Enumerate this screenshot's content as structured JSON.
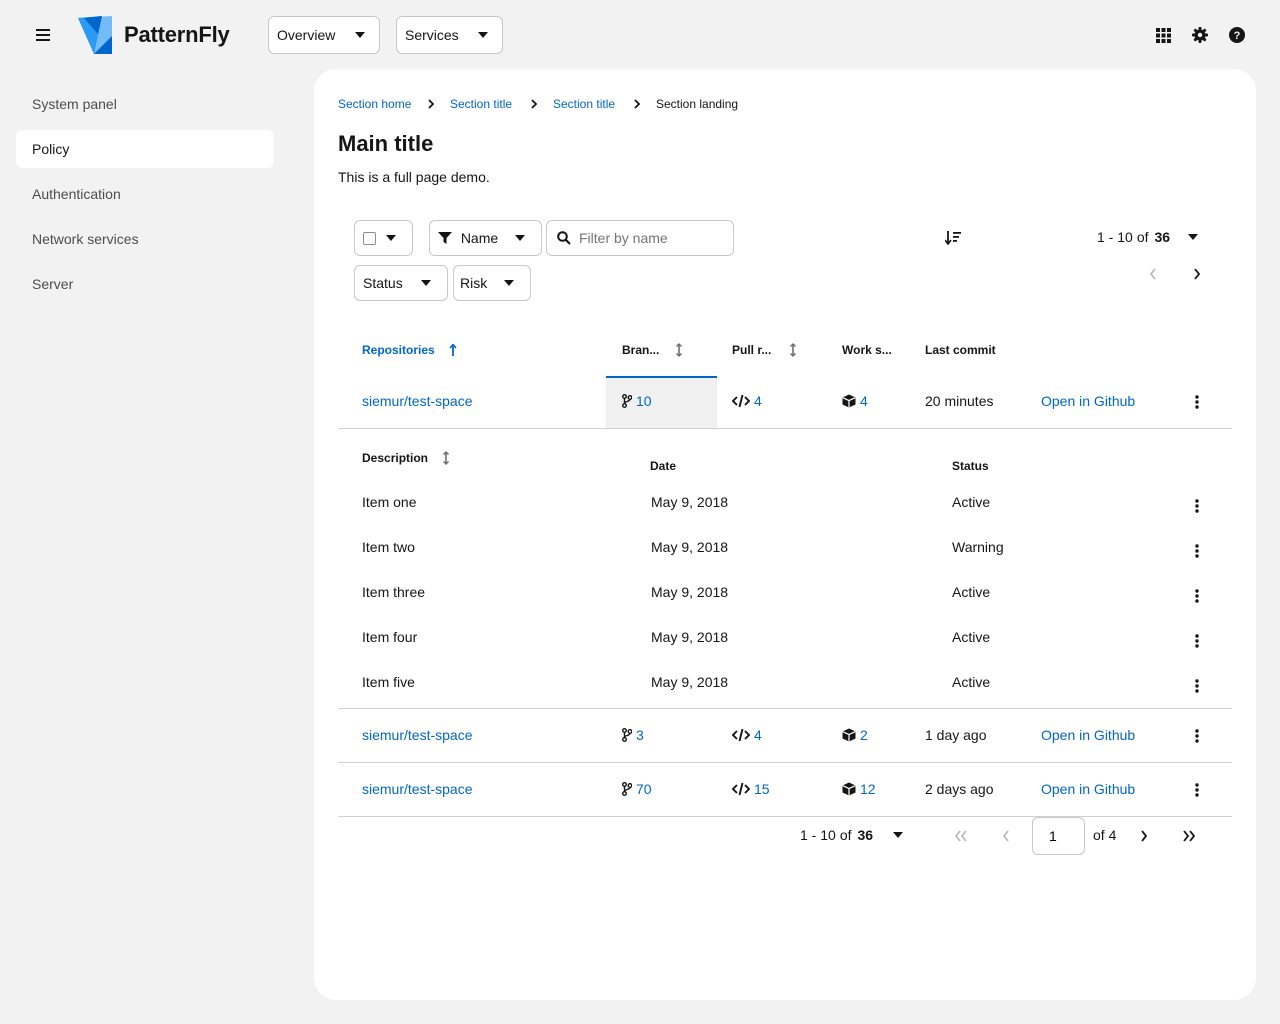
{
  "masthead": {
    "brand": "PatternFly",
    "dropdowns": [
      {
        "label": "Overview"
      },
      {
        "label": "Services"
      }
    ],
    "tools": [
      "apps-grid-icon",
      "settings-icon",
      "help-icon"
    ]
  },
  "sidebar": {
    "items": [
      {
        "label": "System panel",
        "active": false
      },
      {
        "label": "Policy",
        "active": true
      },
      {
        "label": "Authentication",
        "active": false
      },
      {
        "label": "Network services",
        "active": false
      },
      {
        "label": "Server",
        "active": false
      }
    ]
  },
  "breadcrumb": {
    "items": [
      "Section home",
      "Section title",
      "Section title"
    ],
    "current": "Section landing"
  },
  "page": {
    "title": "Main title",
    "description": "This is a full page demo."
  },
  "toolbar": {
    "filter_attribute": "Name",
    "search_placeholder": "Filter by name",
    "status_label": "Status",
    "risk_label": "Risk",
    "pagination_range": "1 - 10",
    "pagination_of": "of",
    "pagination_total": "36"
  },
  "table": {
    "columns": {
      "repositories": "Repositories",
      "branches": "Bran...",
      "pull_requests": "Pull r...",
      "workspaces": "Work s...",
      "last_commit": "Last commit"
    },
    "rows": [
      {
        "repo": "siemur/test-space",
        "branches": "10",
        "pull_requests": "4",
        "workspaces": "4",
        "last_commit": "20 minutes",
        "action": "Open in Github"
      },
      {
        "repo": "siemur/test-space",
        "branches": "3",
        "pull_requests": "4",
        "workspaces": "2",
        "last_commit": "1 day ago",
        "action": "Open in Github"
      },
      {
        "repo": "siemur/test-space",
        "branches": "70",
        "pull_requests": "15",
        "workspaces": "12",
        "last_commit": "2 days ago",
        "action": "Open in Github"
      }
    ],
    "expanded": {
      "columns": {
        "description": "Description",
        "date": "Date",
        "status": "Status"
      },
      "rows": [
        {
          "description": "Item one",
          "date": "May 9, 2018",
          "status": "Active"
        },
        {
          "description": "Item two",
          "date": "May 9, 2018",
          "status": "Warning"
        },
        {
          "description": "Item three",
          "date": "May 9, 2018",
          "status": "Active"
        },
        {
          "description": "Item four",
          "date": "May 9, 2018",
          "status": "Active"
        },
        {
          "description": "Item five",
          "date": "May 9, 2018",
          "status": "Active"
        }
      ]
    }
  },
  "footer_pagination": {
    "range": "1 - 10",
    "of": "of",
    "total": "36",
    "current_page": "1",
    "page_of": "of 4"
  },
  "colors": {
    "link": "#0066cc",
    "accent": "#0066cc",
    "background": "#f2f2f2",
    "panel": "#ffffff"
  }
}
